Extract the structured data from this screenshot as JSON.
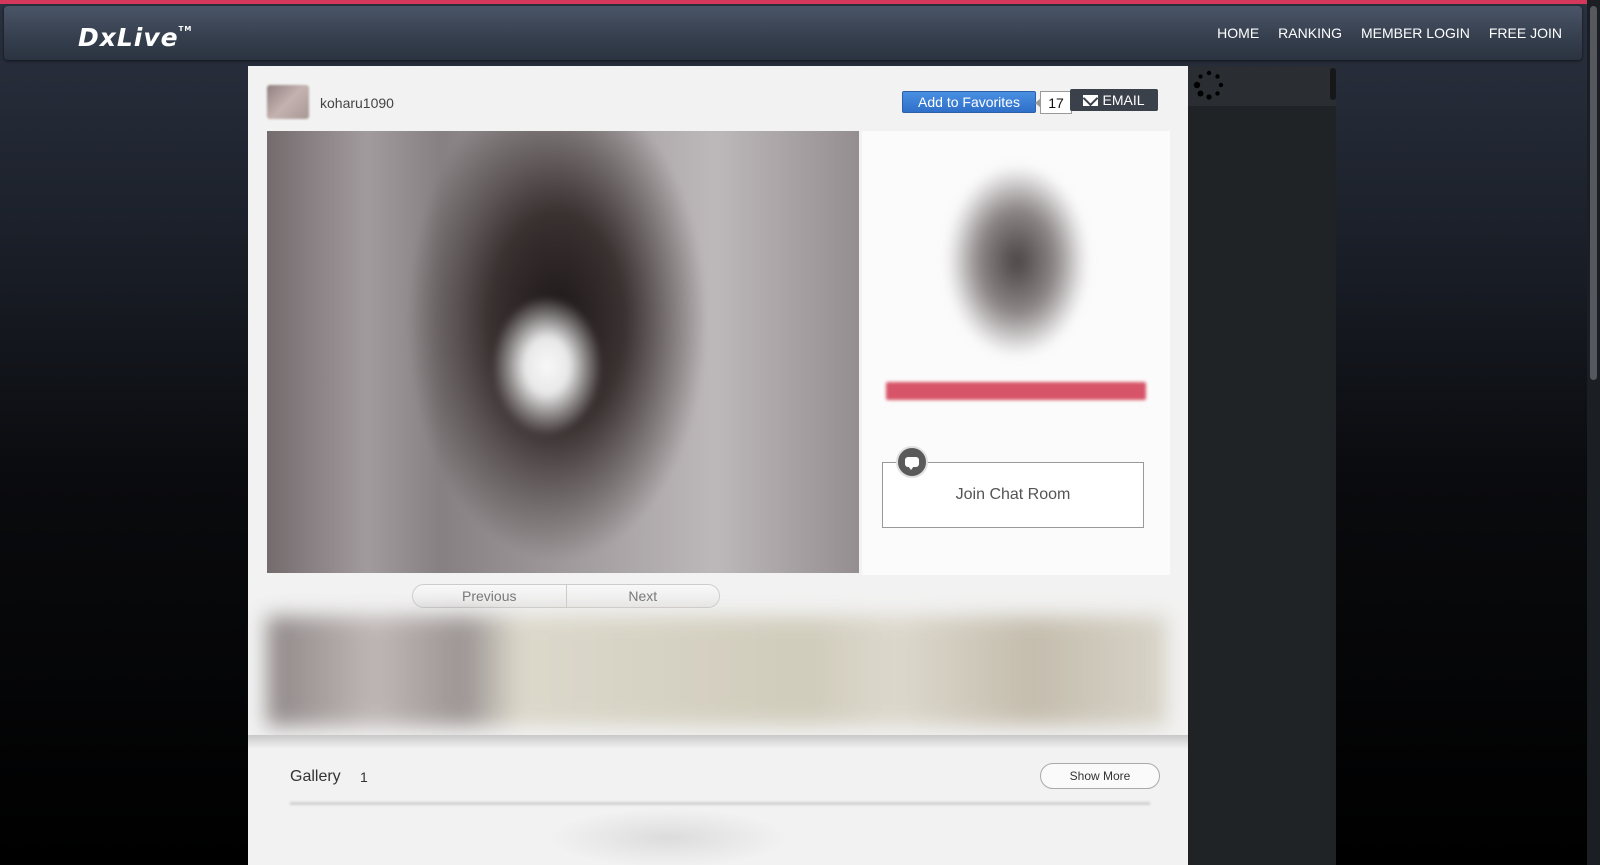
{
  "brand": {
    "logo_text": "DxLive",
    "tm": "TM"
  },
  "nav": {
    "items": [
      "HOME",
      "RANKING",
      "MEMBER LOGIN",
      "FREE JOIN"
    ]
  },
  "performer": {
    "username": "koharu1090",
    "favorite_label": "Add to Favorites",
    "favorite_count": "17",
    "email_label": "EMAIL"
  },
  "chat": {
    "join_label": "Join Chat Room"
  },
  "pager": {
    "previous": "Previous",
    "next": "Next"
  },
  "gallery": {
    "label": "Gallery",
    "count": "1",
    "show_more": "Show More"
  },
  "colors": {
    "accent": "#d5385a",
    "navbar": "#36404f",
    "favorite_button": "#2f6fc9",
    "email_button": "#3b414b",
    "profile_bar": "#d85468"
  },
  "icons": {
    "email": "mail-icon",
    "chat": "chat-bubble-icon",
    "loading": "spinner-icon"
  }
}
